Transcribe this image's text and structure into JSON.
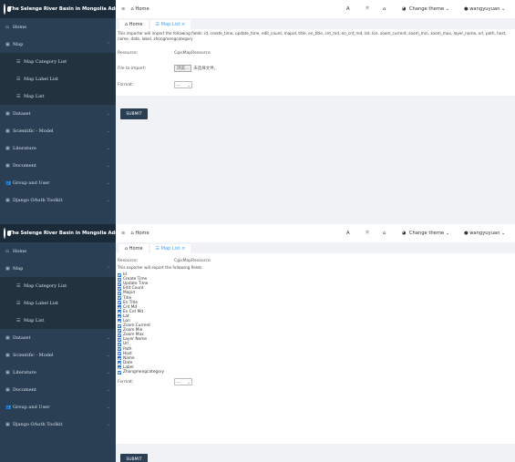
{
  "app_title": "The Selenge River Basin in Mongolia Admin",
  "sidebar": {
    "items": [
      {
        "label": "Home",
        "icon": "home-icon"
      },
      {
        "label": "Map",
        "icon": "map-icon",
        "expanded": true
      },
      {
        "label": "Map Category List",
        "icon": "list-icon",
        "sub": true
      },
      {
        "label": "Map Label List",
        "icon": "list-icon",
        "sub": true
      },
      {
        "label": "Map List",
        "icon": "list-icon",
        "sub": true,
        "active": true
      },
      {
        "label": "Dataset",
        "icon": "dataset-icon"
      },
      {
        "label": "Scientific - Model",
        "icon": "model-icon"
      },
      {
        "label": "Literature",
        "icon": "literature-icon"
      },
      {
        "label": "Document",
        "icon": "document-icon"
      },
      {
        "label": "Group and User",
        "icon": "users-icon"
      },
      {
        "label": "Django OAuth Toolkit",
        "icon": "oauth-icon"
      }
    ]
  },
  "topbar": {
    "home_label": "Home",
    "change_theme": "Change theme",
    "username": "wangyuyuan"
  },
  "tabs": [
    {
      "label": "Home"
    },
    {
      "label": "Map List",
      "active": true
    }
  ],
  "import_view": {
    "note": "This importer will import the following fields: id, create_time, update_time, edit_count, mapid, title, en_title, cnt_md, en_cnt_md, lat, lon, zoom_current, zoom_min, zoom_max, layer_name, url, path, host, name, date, label, zhongmengcategory",
    "resource_label": "Resource:",
    "resource_value": "CgisMapResource",
    "file_label": "File to import:",
    "file_button": "浏览...",
    "file_status": "未选择文件。",
    "format_label": "Format:",
    "format_value": "---",
    "submit": "SUBMIT"
  },
  "export_view": {
    "resource_label": "Resource:",
    "resource_value": "CgisMapResource",
    "note": "This exporter will export the following fields:",
    "fields": [
      "Id",
      "Create Time",
      "Update Time",
      "Edit Count",
      "Mapid",
      "Title",
      "En Title",
      "Cnt Md",
      "En Cnt Md",
      "Lat",
      "Lon",
      "Zoom Current",
      "Zoom Min",
      "Zoom Max",
      "Layer Name",
      "Url",
      "Path",
      "Host",
      "Name",
      "Date",
      "Label",
      "Zhongmengcategory"
    ],
    "format_label": "Format:",
    "format_value": "---",
    "submit": "SUBMIT"
  }
}
